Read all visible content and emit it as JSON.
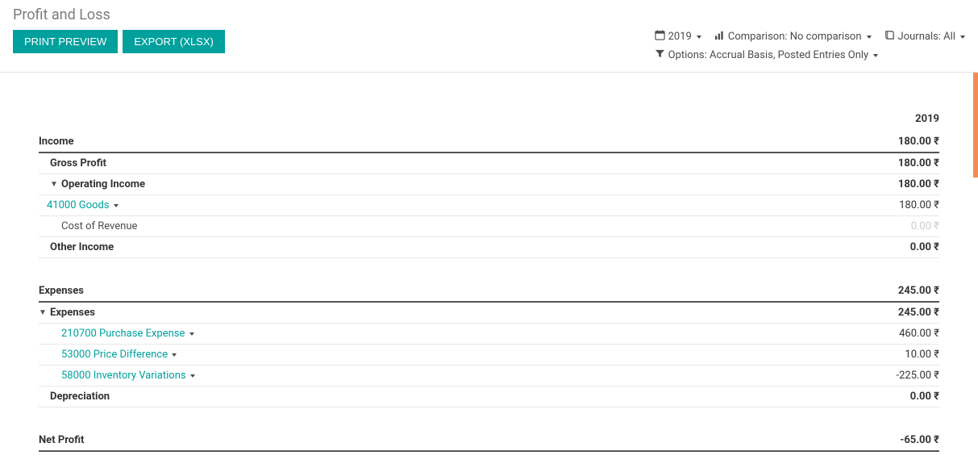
{
  "header": {
    "title": "Profit and Loss",
    "print_preview_label": "PRINT PREVIEW",
    "export_label": "EXPORT (XLSX)"
  },
  "filters": {
    "year": "2019",
    "comparison_label": "Comparison: No comparison",
    "journals_label": "Journals: All",
    "options_label": "Options: Accrual Basis, Posted Entries Only"
  },
  "report": {
    "column_header": "2019",
    "sections": [
      {
        "name": "Income",
        "value": "180.00 ₹",
        "rows": [
          {
            "label": "Gross Profit",
            "value": "180.00 ₹",
            "bold": true,
            "indent": 1
          },
          {
            "label": "Operating Income",
            "value": "180.00 ₹",
            "bold": true,
            "indent": 2,
            "expanded": true
          },
          {
            "label": "41000 Goods",
            "value": "180.00 ₹",
            "link": true,
            "indent": 3,
            "dropdown": true
          },
          {
            "label": "Cost of Revenue",
            "value": "0.00 ₹",
            "indent": 2,
            "muted": true
          },
          {
            "label": "Other Income",
            "value": "0.00 ₹",
            "bold": true,
            "indent": 1
          }
        ]
      },
      {
        "name": "Expenses",
        "value": "245.00 ₹",
        "rows": [
          {
            "label": "Expenses",
            "value": "245.00 ₹",
            "bold": true,
            "indent": 1,
            "expanded": true
          },
          {
            "label": "210700 Purchase Expense",
            "value": "460.00 ₹",
            "link": true,
            "indent": 2,
            "dropdown": true
          },
          {
            "label": "53000 Price Difference",
            "value": "10.00 ₹",
            "link": true,
            "indent": 2,
            "dropdown": true
          },
          {
            "label": "58000 Inventory Variations",
            "value": "-225.00 ₹",
            "link": true,
            "indent": 2,
            "dropdown": true
          },
          {
            "label": "Depreciation",
            "value": "0.00 ₹",
            "bold": true,
            "indent": 1
          }
        ]
      }
    ],
    "net_profit": {
      "label": "Net Profit",
      "value": "-65.00 ₹"
    }
  }
}
